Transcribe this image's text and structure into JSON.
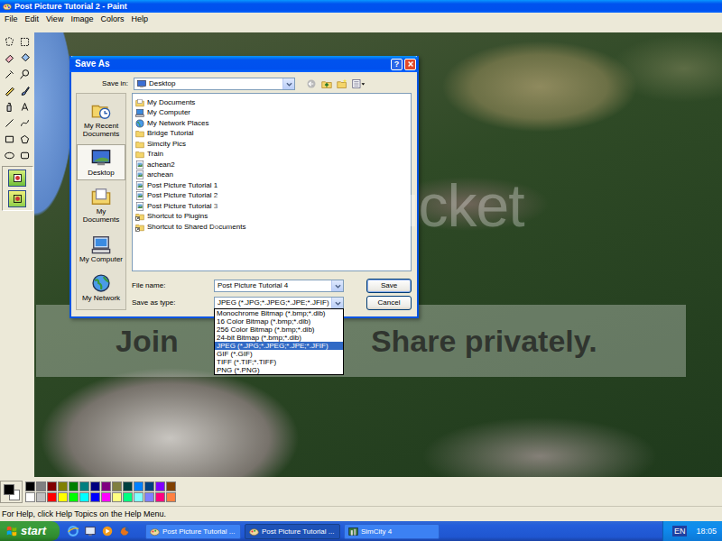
{
  "window": {
    "title": "Post Picture Tutorial 2 - Paint"
  },
  "menu": [
    "File",
    "Edit",
    "View",
    "Image",
    "Colors",
    "Help"
  ],
  "canvas": {
    "watermark": "photobucket",
    "banner": [
      "Join",
      "Share privately."
    ]
  },
  "status_bar": "For Help, click Help Topics on the Help Menu.",
  "dialog": {
    "title": "Save As",
    "help_button": "?",
    "save_in": {
      "label": "Save in:",
      "value": "Desktop"
    },
    "places": [
      {
        "label": "My Recent Documents",
        "kind": "recent",
        "selected": false
      },
      {
        "label": "Desktop",
        "kind": "desktop",
        "selected": true
      },
      {
        "label": "My Documents",
        "kind": "documents",
        "selected": false
      },
      {
        "label": "My Computer",
        "kind": "computer",
        "selected": false
      },
      {
        "label": "My Network",
        "kind": "network",
        "selected": false
      }
    ],
    "files": [
      {
        "name": "My Documents",
        "kind": "documents"
      },
      {
        "name": "My Computer",
        "kind": "computer"
      },
      {
        "name": "My Network Places",
        "kind": "network"
      },
      {
        "name": "Bridge Tutorial",
        "kind": "folder"
      },
      {
        "name": "Simcity Pics",
        "kind": "folder"
      },
      {
        "name": "Train",
        "kind": "folder"
      },
      {
        "name": "achean2",
        "kind": "image"
      },
      {
        "name": "archean",
        "kind": "image"
      },
      {
        "name": "Post Picture Tutorial 1",
        "kind": "image"
      },
      {
        "name": "Post Picture Tutorial 2",
        "kind": "image"
      },
      {
        "name": "Post Picture Tutorial 3",
        "kind": "image"
      },
      {
        "name": "Shortcut to Plugins",
        "kind": "shortcut"
      },
      {
        "name": "Shortcut to Shared Documents",
        "kind": "shortcut"
      }
    ],
    "file_name": {
      "label": "File name:",
      "value": "Post Picture Tutorial 4"
    },
    "file_type": {
      "label": "Save as type:",
      "value": "JPEG (*.JPG;*.JPEG;*.JPE;*.JFIF)",
      "expanded": true,
      "options": [
        {
          "label": "Monochrome Bitmap (*.bmp;*.dib)",
          "selected": false
        },
        {
          "label": "16 Color Bitmap (*.bmp;*.dib)",
          "selected": false
        },
        {
          "label": "256 Color Bitmap (*.bmp;*.dib)",
          "selected": false
        },
        {
          "label": "24-bit Bitmap (*.bmp;*.dib)",
          "selected": false
        },
        {
          "label": "JPEG (*.JPG;*.JPEG;*.JPE;*.JFIF)",
          "selected": true
        },
        {
          "label": "GIF (*.GIF)",
          "selected": false
        },
        {
          "label": "TIFF (*.TIF;*.TIFF)",
          "selected": false
        },
        {
          "label": "PNG (*.PNG)",
          "selected": false
        }
      ]
    },
    "buttons": [
      "Save",
      "Cancel"
    ]
  },
  "taskbar": {
    "start": "start",
    "tasks": [
      {
        "label": "Post Picture Tutorial ...",
        "kind": "paint",
        "selected": false
      },
      {
        "label": "Post Picture Tutorial ...",
        "kind": "paint",
        "selected": true
      },
      {
        "label": "SimCity 4",
        "kind": "game",
        "selected": false
      }
    ],
    "language": "EN",
    "clock": "18:05"
  }
}
